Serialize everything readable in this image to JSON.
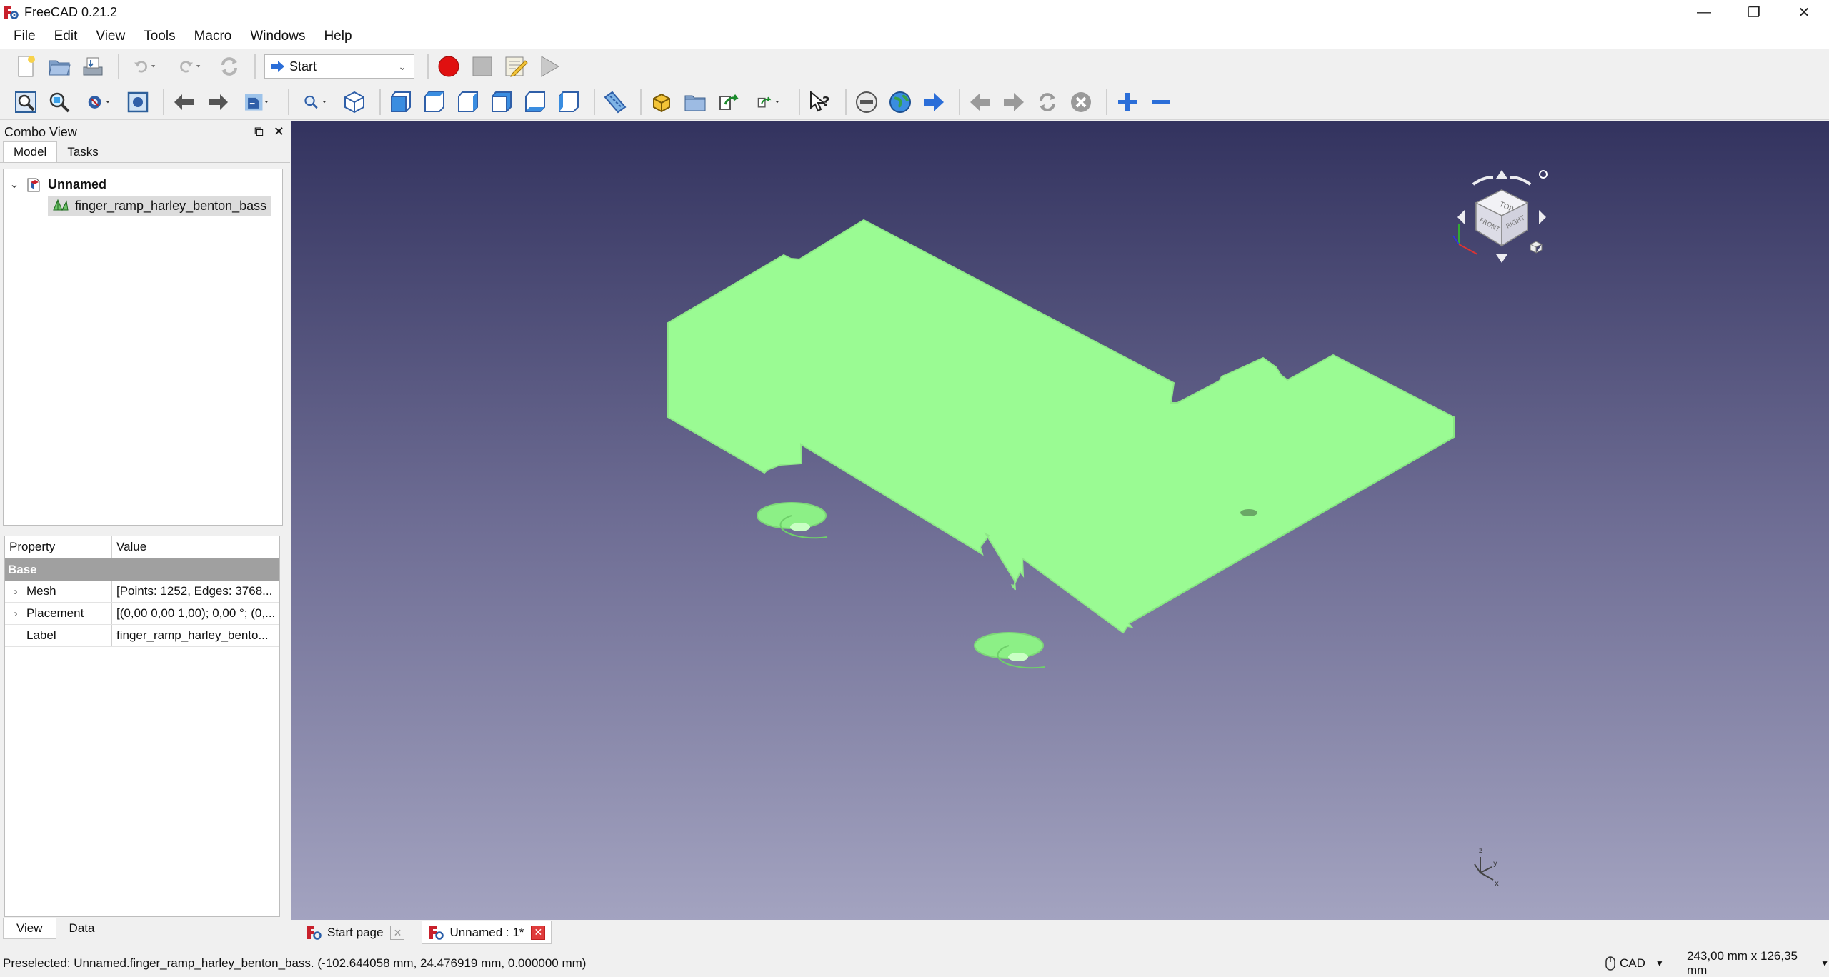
{
  "window": {
    "title": "FreeCAD 0.21.2",
    "controls": [
      "—",
      "❐",
      "✕"
    ]
  },
  "menu": [
    "File",
    "Edit",
    "View",
    "Tools",
    "Macro",
    "Windows",
    "Help"
  ],
  "workbench": {
    "selected": "Start"
  },
  "combo": {
    "title": "Combo View",
    "tabs": [
      "Model",
      "Tasks"
    ],
    "bottom_tabs": [
      "View",
      "Data"
    ],
    "tree": {
      "root": "Unnamed",
      "child": "finger_ramp_harley_benton_bass"
    },
    "props": {
      "headers": [
        "Property",
        "Value"
      ],
      "group": "Base",
      "rows": [
        {
          "name": "Mesh",
          "value": "[Points: 1252, Edges: 3768..."
        },
        {
          "name": "Placement",
          "value": "[(0,00 0,00 1,00); 0,00 °; (0,..."
        },
        {
          "name": "Label",
          "value": "finger_ramp_harley_bento..."
        }
      ]
    }
  },
  "doc_tabs": [
    {
      "label": "Start page"
    },
    {
      "label": "Unnamed : 1*"
    }
  ],
  "navcube": {
    "faces": [
      "TOP",
      "FRONT",
      "RIGHT"
    ]
  },
  "axis": {
    "x": "x",
    "y": "y",
    "z": "z"
  },
  "status": {
    "message": "Preselected: Unnamed.finger_ramp_harley_benton_bass. (-102.644058 mm, 24.476919 mm, 0.000000 mm)",
    "nav_style": "CAD",
    "dimensions": "243,00 mm x 126,35 mm"
  },
  "colors": {
    "model": "#9afb93",
    "viewport_top": "#33335f",
    "viewport_bottom": "#a3a3c0",
    "record": "#e01010"
  },
  "icons": {
    "toolbar1": [
      "new-icon",
      "open-icon",
      "save-icon",
      "undo-icon",
      "redo-icon",
      "refresh-icon",
      "macro-record-icon",
      "macro-stop-icon",
      "macro-edit-icon",
      "macro-run-icon"
    ],
    "toolbar2": [
      "fit-all-icon",
      "fit-selection-icon",
      "draw-style-icon",
      "bounding-box-icon",
      "back-icon",
      "forward-icon",
      "sync-view-icon",
      "std-views-icon",
      "isometric-icon",
      "front-view-icon",
      "top-view-icon",
      "right-view-icon",
      "rear-view-icon",
      "bottom-view-icon",
      "left-view-icon",
      "measure-icon",
      "part-icon",
      "group-icon",
      "link-icon",
      "link-actions-icon",
      "whats-this-icon",
      "web-stop-icon",
      "web-home-icon",
      "web-go-icon",
      "web-back-icon",
      "web-next-icon",
      "web-refresh-icon",
      "web-cancel-icon",
      "zoom-in-icon",
      "zoom-out-icon"
    ]
  }
}
